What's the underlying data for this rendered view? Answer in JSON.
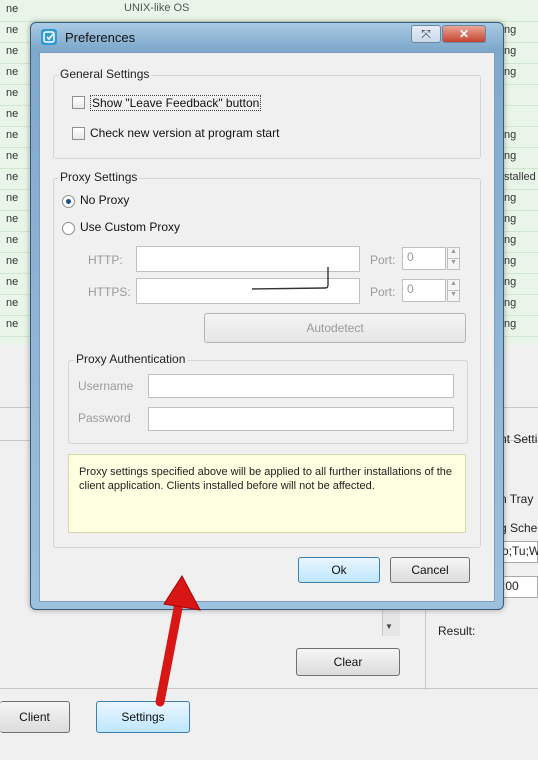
{
  "background": {
    "top_cell": "UNIX-like OS",
    "left_cells": [
      "ne",
      "ne",
      "ne",
      "ne",
      "ne",
      "ne",
      "ne",
      "ne",
      "ne",
      "ne",
      "ne",
      "ne",
      "ne",
      "ne",
      "ne",
      "ne"
    ],
    "right_cells": [
      "ng",
      "ng",
      "ng",
      "ng",
      "ng",
      "stalled",
      "ng",
      "ng",
      "ng",
      "ng",
      "ng",
      "ng",
      "ng"
    ],
    "side_labels": {
      "settings_frag": "nt Setti",
      "tray_frag": "n Tray",
      "schedule_frag": "g Sche",
      "days_frag": "o;Tu;W",
      "time_frag": ":00",
      "result": "Result:"
    },
    "buttons": {
      "clear": "Clear",
      "client": "Client",
      "settings": "Settings"
    }
  },
  "dialog": {
    "title": "Preferences",
    "title_buttons": {
      "resize": "⤧",
      "close": "✕"
    },
    "general": {
      "legend": "General Settings",
      "show_feedback": "Show \"Leave Feedback\" button",
      "check_version": "Check new version at program start"
    },
    "proxy": {
      "legend": "Proxy Settings",
      "no_proxy": "No Proxy",
      "custom_proxy": "Use Custom Proxy",
      "http_label": "HTTP:",
      "https_label": "HTTPS:",
      "port_label": "Port:",
      "http_port": "0",
      "https_port": "0",
      "autodetect": "Autodetect"
    },
    "auth": {
      "legend": "Proxy Authentication",
      "username": "Username",
      "password": "Password"
    },
    "note": "Proxy settings specified above will be applied to all further installations of the client application. Clients installed before will not be affected.",
    "ok": "Ok",
    "cancel": "Cancel"
  },
  "colors": {
    "arrow": "#e01818",
    "selection": "#e8f5e8"
  }
}
